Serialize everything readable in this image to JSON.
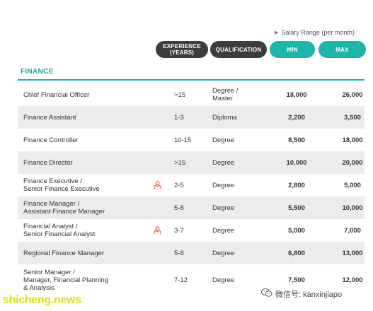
{
  "header": {
    "salary_note": "Salary Range (per month)",
    "columns": {
      "experience": "EXPERIENCE\n(YEARS)",
      "qualification": "QUALIFICATION",
      "min": "MIN",
      "max": "MAX"
    }
  },
  "section": {
    "title": "FINANCE"
  },
  "rows": [
    {
      "title": "Chief Financial Officer",
      "icon": false,
      "experience": ">15",
      "qualification": "Degree /\nMaster",
      "min": "18,000",
      "max": "26,000"
    },
    {
      "title": "Finance Assistant",
      "icon": false,
      "experience": "1-3",
      "qualification": "Diploma",
      "min": "2,200",
      "max": "3,500"
    },
    {
      "title": "Finance Controller",
      "icon": false,
      "experience": "10-15",
      "qualification": "Degree",
      "min": "8,500",
      "max": "18,000"
    },
    {
      "title": "Finance Director",
      "icon": false,
      "experience": ">15",
      "qualification": "Degree",
      "min": "10,000",
      "max": "20,000"
    },
    {
      "title": "Finance Executive /\nSenior Finance Executive",
      "icon": true,
      "experience": "2-5",
      "qualification": "Degree",
      "min": "2,800",
      "max": "5,000"
    },
    {
      "title": "Finance Manager /\nAssistant Finance Manager",
      "icon": false,
      "experience": "5-8",
      "qualification": "Degree",
      "min": "5,500",
      "max": "10,000"
    },
    {
      "title": "Financial Analyst /\nSenior Financial Analyst",
      "icon": true,
      "experience": "3-7",
      "qualification": "Degree",
      "min": "5,000",
      "max": "7,000"
    },
    {
      "title": "Regional Finance Manager",
      "icon": false,
      "experience": "5-8",
      "qualification": "Degree",
      "min": "6,800",
      "max": "13,000"
    },
    {
      "title": "Senior Manager /\nManager, Financial Planning\n& Analysis",
      "icon": false,
      "experience": "7-12",
      "qualification": "Degree",
      "min": "7,500",
      "max": "12,000"
    }
  ],
  "overlays": {
    "watermark": "shicheng.news",
    "wechat_label": "微信号: kanxinjiapo"
  },
  "colors": {
    "accent": "#1bb5a9",
    "dark_pill": "#3d3d3d",
    "icon": "#e0653a"
  },
  "icons": {
    "person": "person-icon",
    "salary_arrow": "triangle-right-icon",
    "wechat": "wechat-icon"
  }
}
